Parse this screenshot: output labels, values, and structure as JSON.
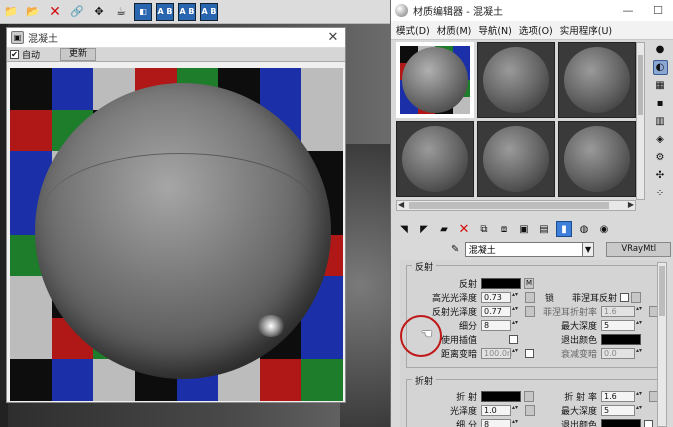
{
  "toolbar": {
    "icons": [
      "folder-icon",
      "open-icon",
      "delete-icon",
      "link-icon",
      "bind-icon",
      "teapot-icon",
      "render-setup-icon",
      "ab-icon",
      "ab-icon-2",
      "ab-icon-3"
    ],
    "ab_label": "A B"
  },
  "preview": {
    "title": "混凝土",
    "auto_label": "自动",
    "update_label": "更新",
    "auto_checked": true,
    "checker_colors": [
      "#0d0d0d",
      "#1a2fa8",
      "#bcbcbc",
      "#b01818",
      "#1d7d2a",
      "#0d0d0d",
      "#1a2fa8",
      "#bcbcbc"
    ]
  },
  "editor": {
    "title": "材质编辑器 - 混凝土",
    "menu": [
      "模式(D)",
      "材质(M)",
      "导航(N)",
      "选项(O)",
      "实用程序(U)"
    ],
    "material_name": "混凝土",
    "material_type": "VRayMtl",
    "reflection": {
      "section": "反射",
      "reflect_label": "反射",
      "m_label": "M",
      "hilight_gloss_label": "高光光泽度",
      "hilight_gloss_value": "0.73",
      "lock_label": "锁",
      "fresnel_label": "菲涅耳反射",
      "refl_gloss_label": "反射光泽度",
      "refl_gloss_value": "0.77",
      "fresnel_ior_label": "菲涅耳折射率",
      "fresnel_ior_value": "1.6",
      "subdivs_label": "细分",
      "subdivs_value": "8",
      "max_depth_label": "最大深度",
      "max_depth_value": "5",
      "use_interp_label": "使用插值",
      "exit_color_label": "退出颜色",
      "dim_distance_label": "距离变暗",
      "dim_distance_value": "100.0n",
      "dim_falloff_label": "衰减变暗",
      "dim_falloff_value": "0.0"
    },
    "refraction": {
      "section": "折射",
      "refract_label": "折 射",
      "ior_label": "折 射 率",
      "ior_value": "1.6",
      "gloss_label": "光泽度",
      "gloss_value": "1.0",
      "max_depth_label": "最大深度",
      "max_depth_value": "5",
      "subdivs_label": "细 分",
      "subdivs_value": "8",
      "exit_color_label": "退出颜色"
    }
  }
}
